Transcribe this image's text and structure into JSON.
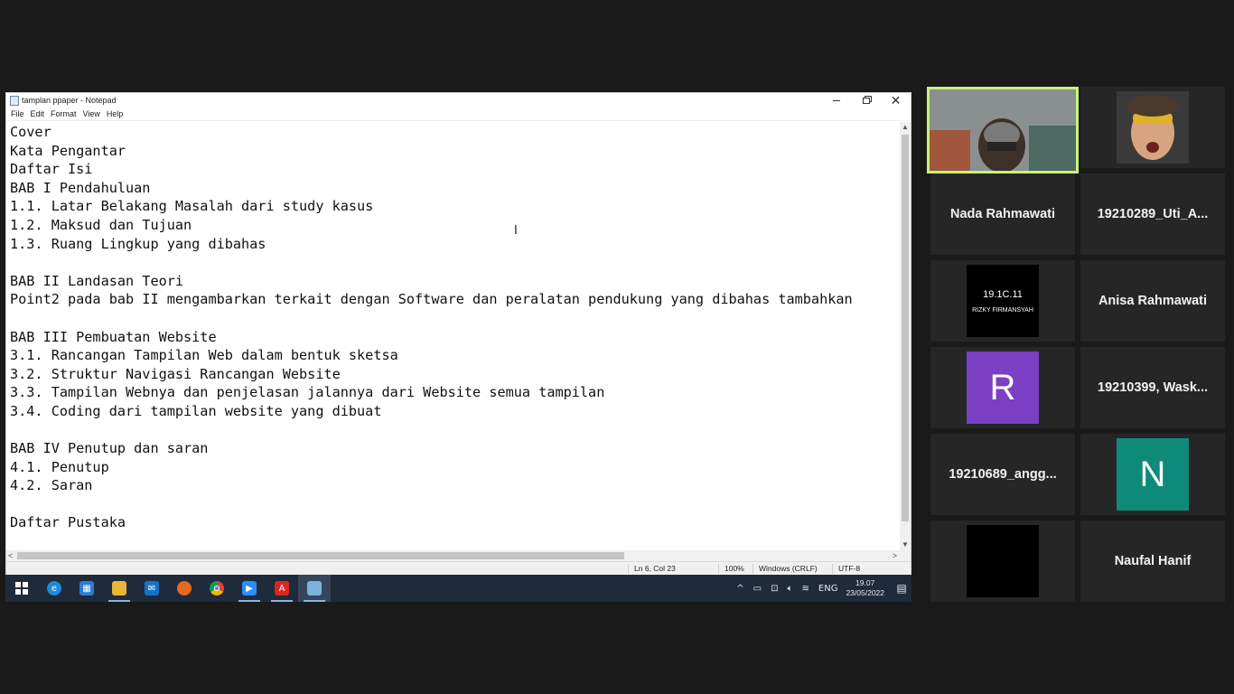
{
  "notepad": {
    "title": "tamplan ppaper - Notepad",
    "menu": [
      "File",
      "Edit",
      "Format",
      "View",
      "Help"
    ],
    "content": "Cover\nKata Pengantar\nDaftar Isi\nBAB I Pendahuluan\n1.1. Latar Belakang Masalah dari study kasus\n1.2. Maksud dan Tujuan\n1.3. Ruang Lingkup yang dibahas\n\nBAB II Landasan Teori\nPoint2 pada bab II mengambarkan terkait dengan Software dan peralatan pendukung yang dibahas tambahkan\n\nBAB III Pembuatan Website\n3.1. Rancangan Tampilan Web dalam bentuk sketsa\n3.2. Struktur Navigasi Rancangan Website\n3.3. Tampilan Webnya dan penjelasan jalannya dari Website semua tampilan\n3.4. Coding dari tampilan website yang dibuat\n\nBAB IV Penutup dan saran\n4.1. Penutup\n4.2. Saran\n\nDaftar Pustaka",
    "status": {
      "position": "Ln 6, Col 23",
      "zoom": "100%",
      "line_ending": "Windows (CRLF)",
      "encoding": "UTF-8"
    }
  },
  "taskbar": {
    "icons": [
      "windows-start-icon",
      "edge-icon",
      "store-icon",
      "file-explorer-icon",
      "mail-icon",
      "firefox-icon",
      "chrome-icon",
      "zoom-icon",
      "acrobat-icon",
      "notepad-icon"
    ],
    "tray": {
      "language": "ENG",
      "time": "19.07",
      "date": "23/05/2022"
    }
  },
  "meeting": {
    "participants": [
      {
        "name": "",
        "kind": "video",
        "active": true
      },
      {
        "name": "",
        "kind": "video"
      },
      {
        "name": "Nada Rahmawati",
        "kind": "name"
      },
      {
        "name": "19210289_Uti_A...",
        "kind": "name"
      },
      {
        "name": "RIZKY FIRMANSYAH",
        "label": "19.1C.11",
        "kind": "card"
      },
      {
        "name": "Anisa Rahmawati",
        "kind": "name"
      },
      {
        "name": "R",
        "kind": "initial",
        "color": "#7a3fc2"
      },
      {
        "name": "19210399, Wask...",
        "kind": "name"
      },
      {
        "name": "19210689_angg...",
        "kind": "name"
      },
      {
        "name": "N",
        "kind": "initial",
        "color": "#0e8a7a"
      },
      {
        "name": "",
        "kind": "blank"
      },
      {
        "name": "Naufal Hanif",
        "kind": "name"
      }
    ]
  },
  "colors": {
    "background": "#1a1a1a",
    "active_speaker_border": "#c9f27a",
    "taskbar": "#1f2b3a"
  }
}
